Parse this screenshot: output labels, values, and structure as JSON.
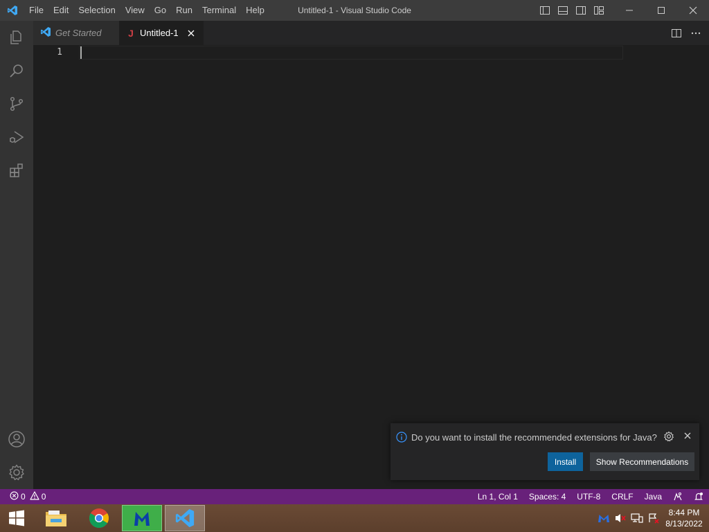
{
  "titlebar": {
    "menu": [
      "File",
      "Edit",
      "Selection",
      "View",
      "Go",
      "Run",
      "Terminal",
      "Help"
    ],
    "title": "Untitled-1 - Visual Studio Code"
  },
  "tabs": [
    {
      "label": "Get Started",
      "icon": "vscode-logo-icon",
      "active": false
    },
    {
      "label": "Untitled-1",
      "icon": "java-file-icon",
      "active": true
    }
  ],
  "editor": {
    "line_numbers": [
      "1"
    ]
  },
  "notification": {
    "message": "Do you want to install the recommended extensions for Java?",
    "install_label": "Install",
    "show_label": "Show Recommendations"
  },
  "statusbar": {
    "errors": "0",
    "warnings": "0",
    "position": "Ln 1, Col 1",
    "spaces": "Spaces: 4",
    "encoding": "UTF-8",
    "eol": "CRLF",
    "language": "Java"
  },
  "taskbar": {
    "time": "8:44 PM",
    "date": "8/13/2022"
  },
  "colors": {
    "statusbar": "#68217a",
    "accent_button": "#0e639c",
    "titlebar": "#3c3c3c",
    "activitybar": "#333333",
    "editor_bg": "#1e1e1e"
  }
}
